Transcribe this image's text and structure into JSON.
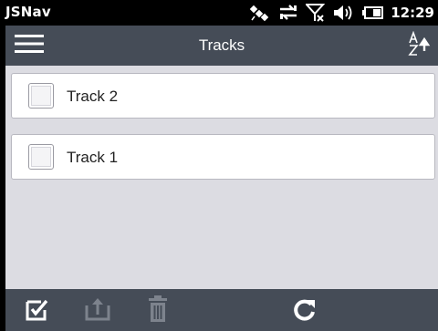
{
  "status_bar": {
    "app_name": "JSNav",
    "time": "12:29",
    "icons": [
      "satellite-icon",
      "data-transfer-icon",
      "no-signal-icon",
      "speaker-icon",
      "battery-icon"
    ]
  },
  "header": {
    "title": "Tracks",
    "menu_icon": "hamburger-menu-icon",
    "sort_icon": "sort-az-ascending-icon"
  },
  "tracks": [
    {
      "label": "Track 2",
      "checked": false
    },
    {
      "label": "Track 1",
      "checked": false
    }
  ],
  "toolbar": {
    "buttons": [
      {
        "icon": "select-all-checkbox-icon",
        "enabled": true
      },
      {
        "icon": "export-icon",
        "enabled": false
      },
      {
        "icon": "trash-icon",
        "enabled": false
      },
      {
        "icon": "refresh-icon",
        "enabled": true
      }
    ]
  },
  "colors": {
    "status_bar_bg": "#000000",
    "title_bar_bg": "#454c57",
    "content_bg": "#dcdce2",
    "item_bg": "#ffffff",
    "enabled_icon": "#ffffff",
    "disabled_icon": "#7d838d"
  }
}
